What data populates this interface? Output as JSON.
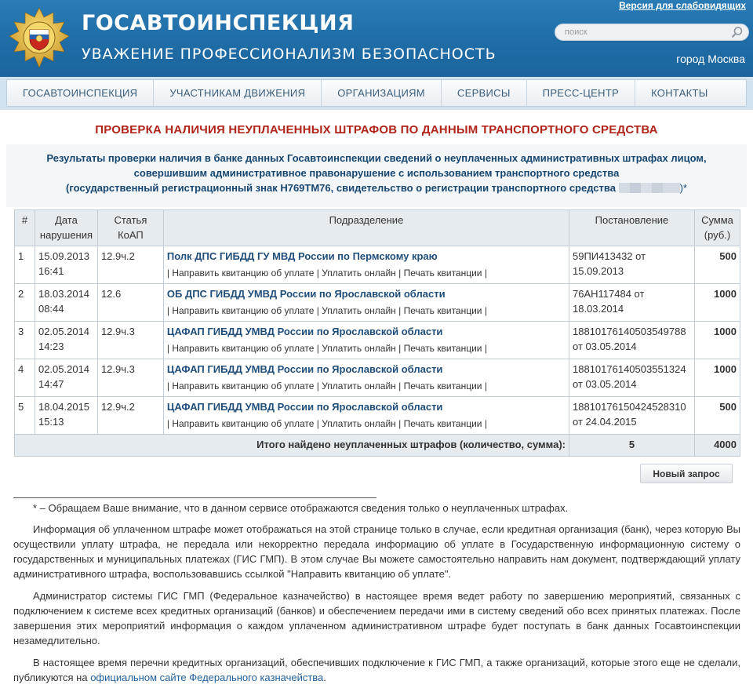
{
  "header": {
    "title": "ГОСАВТОИНСПЕКЦИЯ",
    "motto": "УВАЖЕНИЕ  ПРОФЕССИОНАЛИЗМ  БЕЗОПАСНОСТЬ",
    "vision_link": "Версия для слабовидящих",
    "search_placeholder": "поиск",
    "city": "город Москва"
  },
  "nav": {
    "items": [
      "ГОСАВТОИНСПЕКЦИЯ",
      "УЧАСТНИКАМ ДВИЖЕНИЯ",
      "ОРГАНИЗАЦИЯМ",
      "СЕРВИСЫ",
      "ПРЕСС-ЦЕНТР",
      "КОНТАКТЫ"
    ]
  },
  "page": {
    "heading": "ПРОВЕРКА НАЛИЧИЯ НЕУПЛАЧЕННЫХ ШТРАФОВ ПО ДАННЫМ ТРАНСПОРТНОГО СРЕДСТВА",
    "result_line1": "Результаты проверки наличия в банке данных Госавтоинспекции сведений о неуплаченных административных штрафах лицом,",
    "result_line2": "совершившим административное правонарушение с использованием транспортного средства",
    "result_line3": "(государственный регистрационный знак Н769ТМ76, свидетельство о регистрации транспортного средства",
    "result_tail": ")*"
  },
  "table": {
    "headers": {
      "num": "#",
      "date": "Дата нарушения",
      "article": "Статья КоАП",
      "unit": "Подразделение",
      "decree": "Постановление",
      "sum": "Сумма (руб.)"
    },
    "action_send": "Направить квитанцию об уплате",
    "action_pay": "Уплатить онлайн",
    "action_print": "Печать квитанции",
    "rows": [
      {
        "num": "1",
        "date": "15.09.2013 16:41",
        "article": "12.9ч.2",
        "unit": "Полк ДПС ГИБДД ГУ МВД России по Пермскому краю",
        "decree": "59ПИ413432 от 15.09.2013",
        "sum": "500"
      },
      {
        "num": "2",
        "date": "18.03.2014 08:44",
        "article": "12.6",
        "unit": "ОБ ДПС ГИБДД УМВД России по Ярославской области",
        "decree": "76АН117484 от 18.03.2014",
        "sum": "1000"
      },
      {
        "num": "3",
        "date": "02.05.2014 14:23",
        "article": "12.9ч.3",
        "unit": "ЦАФАП ГИБДД УМВД России по Ярославской области",
        "decree": "18810176140503549788 от 03.05.2014",
        "sum": "1000"
      },
      {
        "num": "4",
        "date": "02.05.2014 14:47",
        "article": "12.9ч.3",
        "unit": "ЦАФАП ГИБДД УМВД России по Ярославской области",
        "decree": "18810176140503551324 от 03.05.2014",
        "sum": "1000"
      },
      {
        "num": "5",
        "date": "18.04.2015 15:13",
        "article": "12.9ч.2",
        "unit": "ЦАФАП ГИБДД УМВД России по Ярославской области",
        "decree": "18810176150424528310 от 24.04.2015",
        "sum": "500"
      }
    ],
    "total_label": "Итого найдено неуплаченных штрафов (количество, сумма):",
    "total_count": "5",
    "total_sum": "4000"
  },
  "buttons": {
    "new_request": "Новый запрос"
  },
  "notes": {
    "footnote": "* – Обращаем Ваше внимание, что в данном сервисе отображаются сведения только о неуплаченных штрафах.",
    "p1": "Информация об уплаченном штрафе может отображаться на этой странице только в случае, если кредитная организация (банк), через которую Вы осуществили уплату штрафа, не передала или некорректно передала информацию об уплате в Государственную информационную систему о государственных и муниципальных платежах (ГИС ГМП). В этом случае Вы можете самостоятельно направить нам документ, подтверждающий уплату административного штрафа, воспользовавшись ссылкой \"Направить квитанцию об уплате\".",
    "p2": "Администратор системы ГИС ГМП (Федеральное казначейство) в настоящее время ведет работу по завершению мероприятий, связанных с подключением к системе всех кредитных организаций (банков) и обеспечением передачи ими в систему сведений обо всех принятых платежах. После завершения этих мероприятий информация о каждом уплаченном административном штрафе будет поступать в банк данных Госавтоинспекции незамедлительно.",
    "p3_text": "В настоящее время перечни кредитных организаций, обеспечивших подключение к ГИС ГМП, а также организаций, которые этого еще не сделали, публикуются на ",
    "p3_link": "официальном сайте Федерального казначейства",
    "p3_end": "."
  }
}
